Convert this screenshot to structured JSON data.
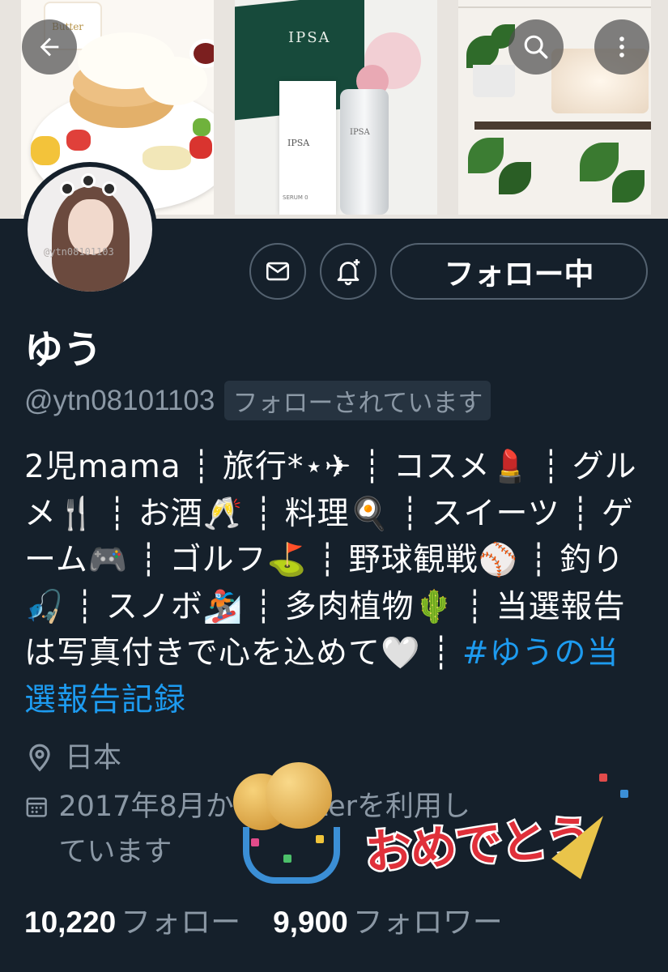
{
  "banner": {
    "pancake_sign": "Butter",
    "ipsa_folder": "IPSA",
    "ipsa_box": "IPSA",
    "ipsa_box_sub": "SERUM 0",
    "ipsa_bottle": "IPSA"
  },
  "avatar": {
    "watermark": "@ytn08101103"
  },
  "actions": {
    "follow_label": "フォロー中"
  },
  "profile": {
    "name": "ゆう",
    "handle": "@ytn08101103",
    "follows_you": "フォローされています",
    "bio_text": "2児mama ┊ 旅行*⋆✈ ┊ コスメ💄 ┊ グルメ🍴 ┊ お酒🥂 ┊ 料理🍳 ┊ スイーツ ┊ ゲーム🎮 ┊ ゴルフ⛳ ┊ 野球観戦⚾ ┊ 釣り🎣 ┊ スノボ🏂 ┊ 多肉植物🌵 ┊ 当選報告は写真付きで心を込めて🤍 ┊ ",
    "bio_hashtag": "#ゆうの当選報告記録",
    "location": "日本",
    "joined": "2017年8月からTwitterを利用しています"
  },
  "stats": {
    "following_count": "10,220",
    "following_label": "フォロー",
    "followers_count": "9,900",
    "followers_label": "フォロワー"
  },
  "sticker": {
    "text": "おめでとう"
  },
  "icons": [
    "back-arrow-icon",
    "search-icon",
    "more-icon",
    "mail-icon",
    "bell-plus-icon",
    "location-icon",
    "calendar-icon"
  ]
}
